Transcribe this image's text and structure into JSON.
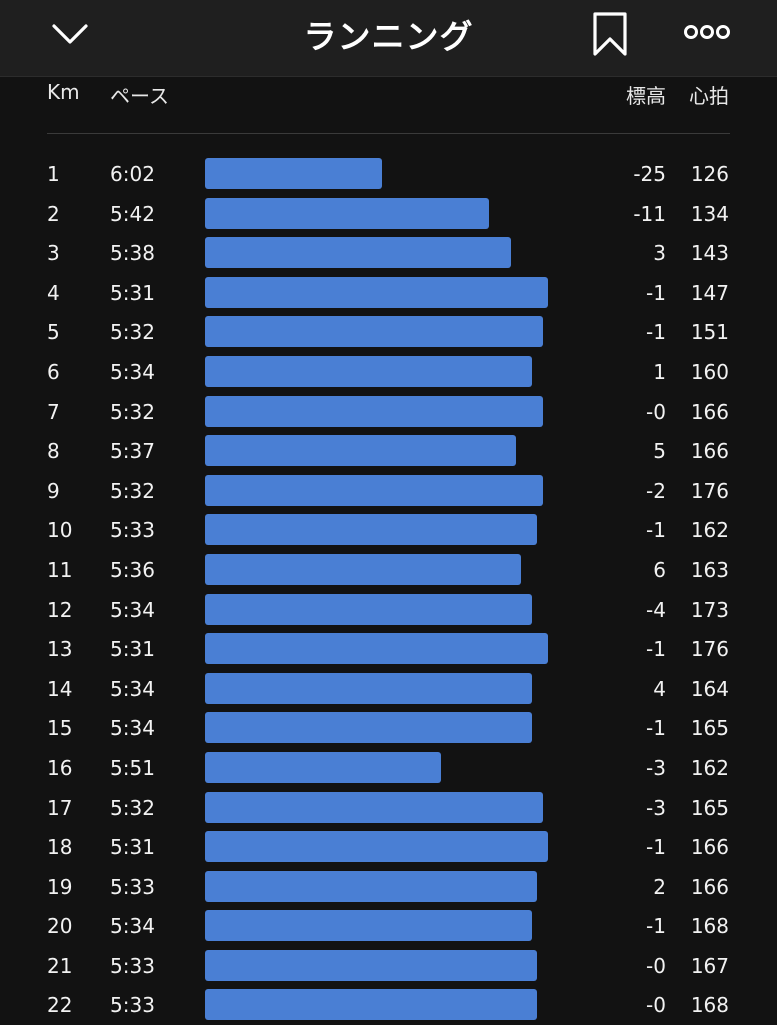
{
  "header": {
    "title": "ランニング",
    "icons": {
      "back": "chevron-down-icon",
      "bookmark": "bookmark-icon",
      "more": "more-options-icon"
    }
  },
  "columns": {
    "km": "Km",
    "pace": "ペース",
    "elevation": "標高",
    "heart_rate": "心拍"
  },
  "colors": {
    "bar": "#4a7fd4",
    "background": "#121212",
    "header_bg": "#1f1f1f"
  },
  "splits": [
    {
      "km": "1",
      "pace": "6:02",
      "pace_seconds": 362,
      "elevation": "-25",
      "heart_rate": "126"
    },
    {
      "km": "2",
      "pace": "5:42",
      "pace_seconds": 342,
      "elevation": "-11",
      "heart_rate": "134"
    },
    {
      "km": "3",
      "pace": "5:38",
      "pace_seconds": 338,
      "elevation": "3",
      "heart_rate": "143"
    },
    {
      "km": "4",
      "pace": "5:31",
      "pace_seconds": 331,
      "elevation": "-1",
      "heart_rate": "147"
    },
    {
      "km": "5",
      "pace": "5:32",
      "pace_seconds": 332,
      "elevation": "-1",
      "heart_rate": "151"
    },
    {
      "km": "6",
      "pace": "5:34",
      "pace_seconds": 334,
      "elevation": "1",
      "heart_rate": "160"
    },
    {
      "km": "7",
      "pace": "5:32",
      "pace_seconds": 332,
      "elevation": "-0",
      "heart_rate": "166"
    },
    {
      "km": "8",
      "pace": "5:37",
      "pace_seconds": 337,
      "elevation": "5",
      "heart_rate": "166"
    },
    {
      "km": "9",
      "pace": "5:32",
      "pace_seconds": 332,
      "elevation": "-2",
      "heart_rate": "176"
    },
    {
      "km": "10",
      "pace": "5:33",
      "pace_seconds": 333,
      "elevation": "-1",
      "heart_rate": "162"
    },
    {
      "km": "11",
      "pace": "5:36",
      "pace_seconds": 336,
      "elevation": "6",
      "heart_rate": "163"
    },
    {
      "km": "12",
      "pace": "5:34",
      "pace_seconds": 334,
      "elevation": "-4",
      "heart_rate": "173"
    },
    {
      "km": "13",
      "pace": "5:31",
      "pace_seconds": 331,
      "elevation": "-1",
      "heart_rate": "176"
    },
    {
      "km": "14",
      "pace": "5:34",
      "pace_seconds": 334,
      "elevation": "4",
      "heart_rate": "164"
    },
    {
      "km": "15",
      "pace": "5:34",
      "pace_seconds": 334,
      "elevation": "-1",
      "heart_rate": "165"
    },
    {
      "km": "16",
      "pace": "5:51",
      "pace_seconds": 351,
      "elevation": "-3",
      "heart_rate": "162"
    },
    {
      "km": "17",
      "pace": "5:32",
      "pace_seconds": 332,
      "elevation": "-3",
      "heart_rate": "165"
    },
    {
      "km": "18",
      "pace": "5:31",
      "pace_seconds": 331,
      "elevation": "-1",
      "heart_rate": "166"
    },
    {
      "km": "19",
      "pace": "5:33",
      "pace_seconds": 333,
      "elevation": "2",
      "heart_rate": "166"
    },
    {
      "km": "20",
      "pace": "5:34",
      "pace_seconds": 334,
      "elevation": "-1",
      "heart_rate": "168"
    },
    {
      "km": "21",
      "pace": "5:33",
      "pace_seconds": 333,
      "elevation": "-0",
      "heart_rate": "167"
    },
    {
      "km": "22",
      "pace": "5:33",
      "pace_seconds": 333,
      "elevation": "-0",
      "heart_rate": "168"
    }
  ]
}
